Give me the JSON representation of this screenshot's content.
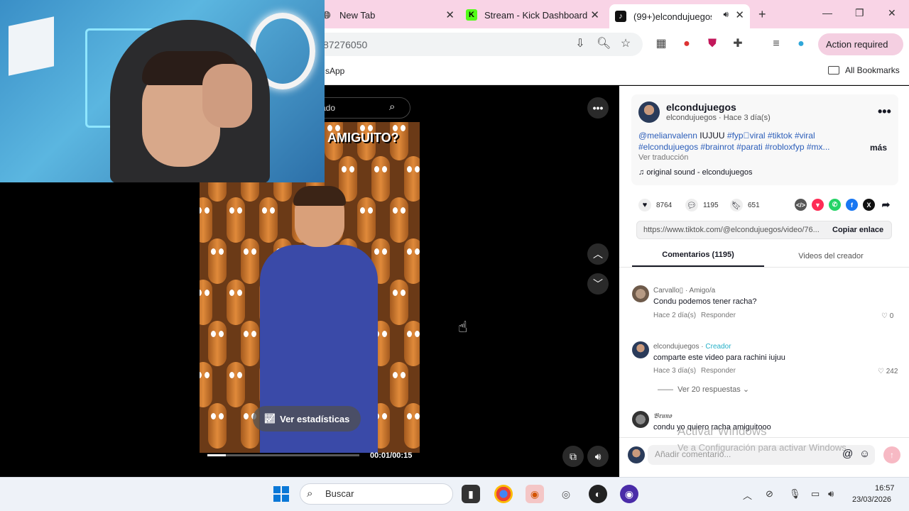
{
  "browser": {
    "tabs": [
      {
        "label": "New Tab",
        "icon": "globe-icon"
      },
      {
        "label": "Stream - Kick Dashboard",
        "icon": "kick-icon"
      },
      {
        "label": "(99+)elcondujuegos",
        "icon": "tiktok-icon"
      }
    ],
    "new_tab_symbol": "+",
    "url_fragment": "87276050",
    "action_required": "Action required",
    "bookmark_app": "sApp",
    "all_bookmarks": "All Bookmarks"
  },
  "video": {
    "caption": "AMIGUITO?",
    "search_fragment": "ado",
    "stats_button": "Ver estadísticas",
    "time": "00:01/00:15",
    "progress": 0.12
  },
  "post": {
    "author": "elcondujuegos",
    "author_sub": "elcondujuegos · Hace 3 día(s)",
    "desc_mention": "@melianvalenn",
    "desc_plain": " IUJUU ",
    "desc_tags_line1": "#fyp゚viral #tiktok #viral",
    "desc_tags_line2": "#elcondujuegos #brainrot #parati #robloxfyp #mx...",
    "more": "más",
    "translate": "Ver traducción",
    "sound": "original sound - elcondujuegos",
    "likes": "8764",
    "comments": "1195",
    "saves": "651",
    "link": "https://www.tiktok.com/@elcondujuegos/video/76...",
    "copy_link": "Copiar enlace"
  },
  "tabs": {
    "comments": "Comentarios (1195)",
    "creator_videos": "Videos del creador"
  },
  "comments": [
    {
      "user": "Carvallo▯",
      "badge": "",
      "suffix": " · Amigo/a",
      "text": "Condu podemos tener racha?",
      "time": "Hace 2 día(s)",
      "reply": "Responder",
      "likes": "0"
    },
    {
      "user": "elcondujuegos",
      "badge": "Creador",
      "suffix": "",
      "text": "comparte este video para rachini iujuu",
      "time": "Hace 3 día(s)",
      "reply": "Responder",
      "likes": "242"
    },
    {
      "user": "𝕭𝖗𝖚𝖓𝖔",
      "badge": "",
      "suffix": "",
      "text": "condu yo quiero racha amiguitooo",
      "time": "",
      "reply": "",
      "likes": ""
    }
  ],
  "replies_toggle": "Ver 20 respuestas",
  "comment_input": {
    "placeholder": "Añadir comentario..."
  },
  "watermark": {
    "line1": "Activar Windows",
    "line2": "Ve a Configuración para activar Windows."
  },
  "taskbar": {
    "search": "Buscar",
    "time": "16:57",
    "date": "23/03/2026"
  },
  "colors": {
    "tab_strip": "#f9d4e6",
    "hashtag": "#2b5db9",
    "creator_badge": "#25b0c8"
  }
}
